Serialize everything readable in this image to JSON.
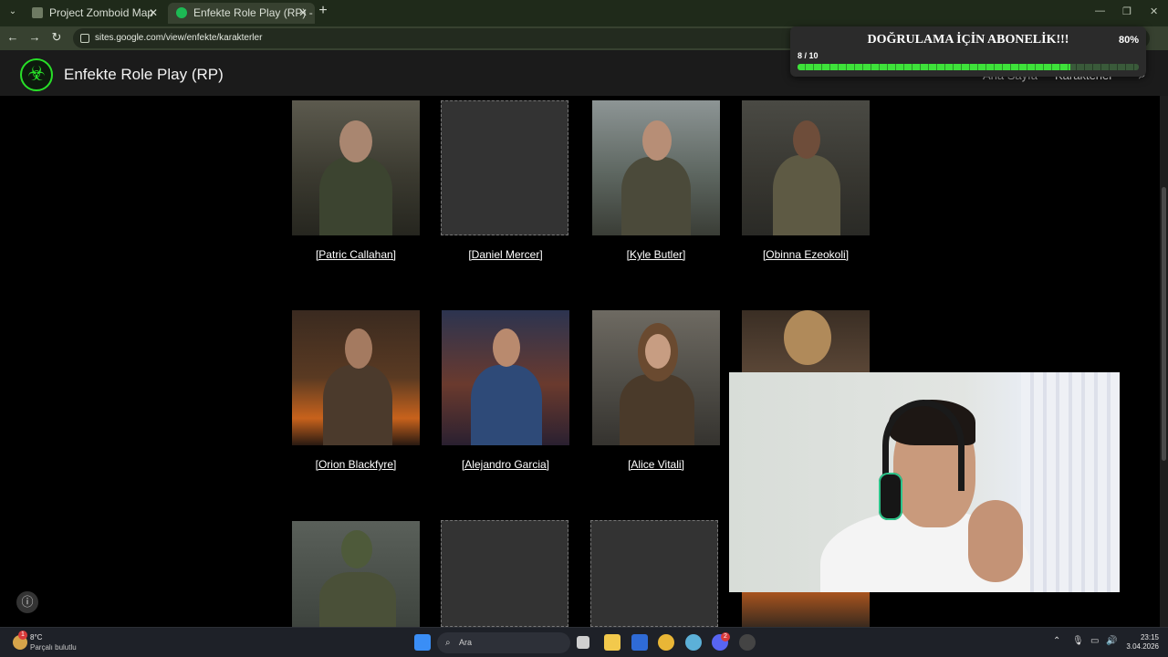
{
  "browser": {
    "tabs": [
      {
        "title": "Project Zomboid Map"
      },
      {
        "title": "Enfekte Role Play (RP) - Karakte"
      }
    ],
    "url": "sites.google.com/view/enfekte/karakterler"
  },
  "site": {
    "title": "Enfekte Role Play (RP)",
    "nav": [
      {
        "label": "Ana Sayfa"
      },
      {
        "label": "Karakterler"
      }
    ]
  },
  "popup": {
    "title": "DOĞRULAMA İÇİN ABONELİK!!!",
    "percent": "80%",
    "progress_text": "8 / 10",
    "progress_fraction": 0.8
  },
  "characters": [
    {
      "name": "[Patric Callahan]",
      "has_image": true
    },
    {
      "name": "[Daniel Mercer]",
      "has_image": false
    },
    {
      "name": "[Kyle Butler]",
      "has_image": true
    },
    {
      "name": "[Obinna Ezeokoli]",
      "has_image": true
    },
    {
      "name": "[Orion Blackfyre]",
      "has_image": true
    },
    {
      "name": "[Alejandro Garcia]",
      "has_image": true
    },
    {
      "name": "[Alice Vitali]",
      "has_image": true
    },
    {
      "name": "",
      "has_image": true
    },
    {
      "name": "",
      "has_image": true
    },
    {
      "name": "",
      "has_image": false
    },
    {
      "name": "",
      "has_image": false
    },
    {
      "name": "",
      "has_image": true
    }
  ],
  "taskbar": {
    "weather_temp": "8°C",
    "weather_desc": "Parçalı bulutlu",
    "weather_badge": "1",
    "search_placeholder": "Ara",
    "discord_badge": "2",
    "time": "23:15",
    "date": "3.04.2026"
  },
  "colors": {
    "accent_green": "#3ee23a",
    "tabbar": "#1f2a1a",
    "addrbar": "#374130"
  }
}
